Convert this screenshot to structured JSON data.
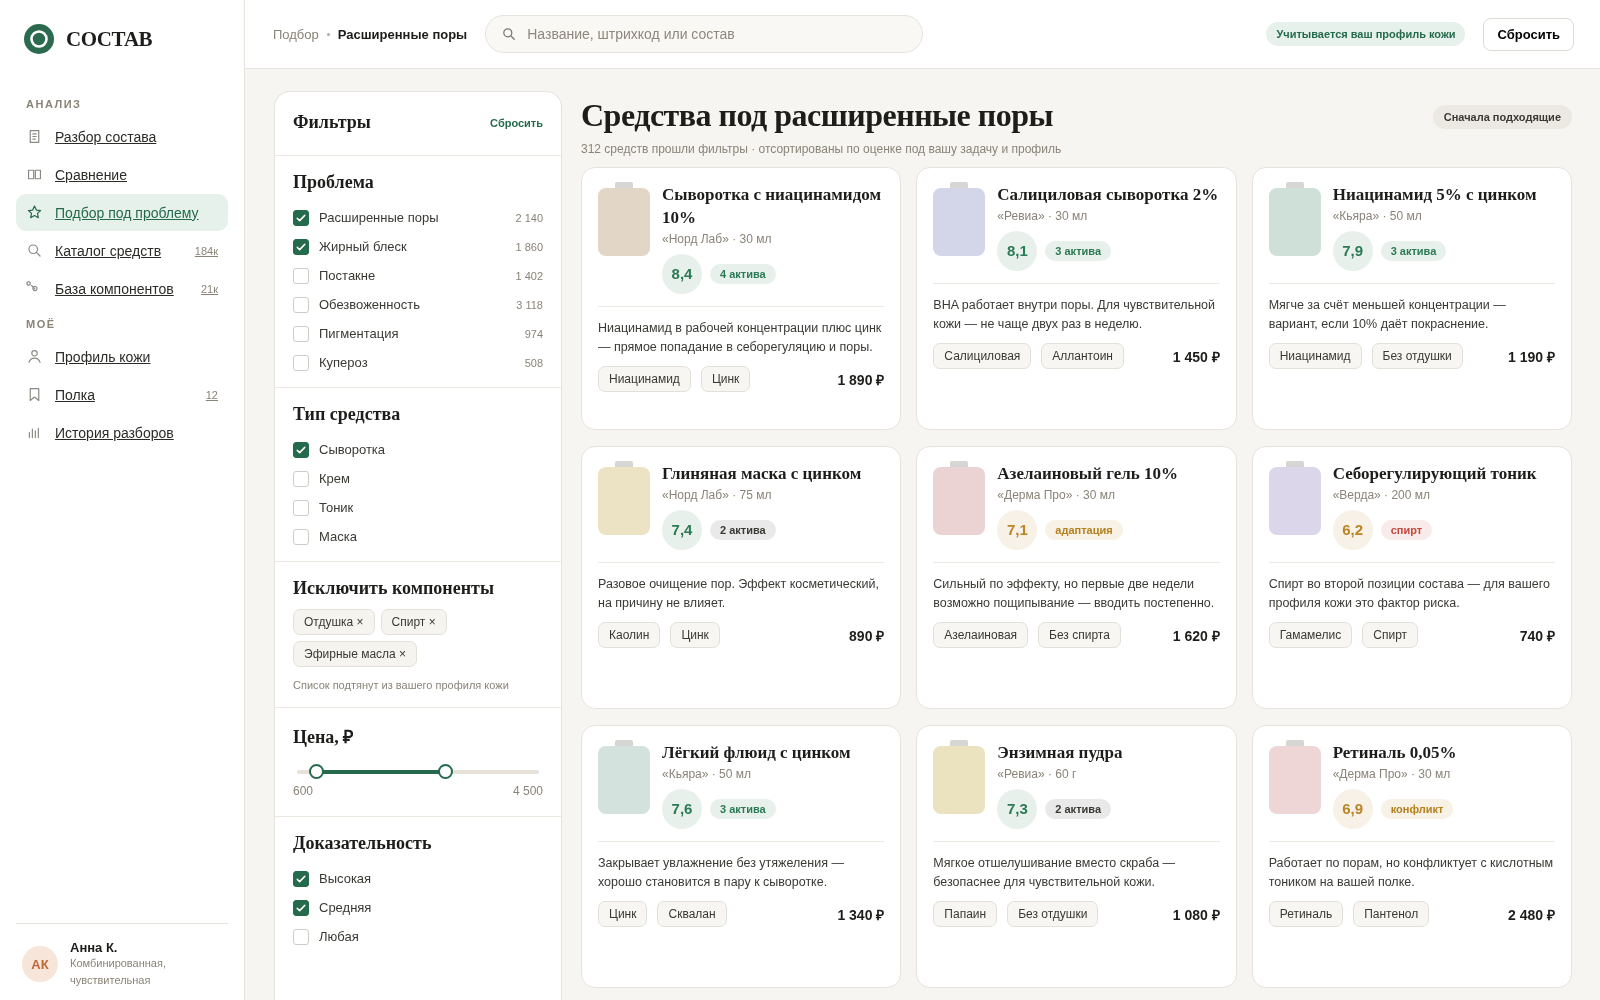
{
  "brand": {
    "name": "СОСТАВ"
  },
  "sidebar": {
    "sections": [
      {
        "title": "АНАЛИЗ",
        "items": [
          {
            "label": "Разбор состава",
            "selected": false
          },
          {
            "label": "Сравнение",
            "selected": false
          },
          {
            "label": "Подбор под проблему",
            "selected": true
          },
          {
            "label": "Каталог средств",
            "count": "184к",
            "selected": false
          },
          {
            "label": "База компонентов",
            "count": "21к",
            "selected": false
          }
        ]
      },
      {
        "title": "МОЁ",
        "items": [
          {
            "label": "Профиль кожи",
            "selected": false
          },
          {
            "label": "Полка",
            "count": "12",
            "selected": false
          },
          {
            "label": "История разборов",
            "selected": false
          }
        ]
      }
    ],
    "user": {
      "initials": "АК",
      "name": "Анна К.",
      "skin": "Комбинированная, чувствительная"
    }
  },
  "topbar": {
    "breadcrumb": [
      "Подбор",
      "Расширенные поры"
    ],
    "search": {
      "placeholder": "Название, штрихкод или состав"
    },
    "profile_badge": "Учитывается ваш профиль кожи",
    "reset_button": "Сбросить"
  },
  "filters": {
    "title": "Фильтры",
    "reset": "Сбросить",
    "problem": {
      "title": "Проблема",
      "options": [
        {
          "label": "Расширенные поры",
          "count": "2 140",
          "checked": true
        },
        {
          "label": "Жирный блеск",
          "count": "1 860",
          "checked": true
        },
        {
          "label": "Постакне",
          "count": "1 402",
          "checked": false
        },
        {
          "label": "Обезвоженность",
          "count": "3 118",
          "checked": false
        },
        {
          "label": "Пигментация",
          "count": "974",
          "checked": false
        },
        {
          "label": "Купероз",
          "count": "508",
          "checked": false
        }
      ]
    },
    "type": {
      "title": "Тип средства",
      "options": [
        {
          "label": "Сыворотка",
          "checked": true
        },
        {
          "label": "Крем",
          "checked": false
        },
        {
          "label": "Тоник",
          "checked": false
        },
        {
          "label": "Маска",
          "checked": false
        }
      ]
    },
    "exclude": {
      "title": "Исключить компоненты",
      "chips": [
        "Отдушка ×",
        "Спирт ×",
        "Эфирные масла ×"
      ],
      "note": "Список подтянут из вашего профиля кожи"
    },
    "price": {
      "title": "Цена, ₽",
      "thumbs": [
        {
          "level": 0.08
        },
        {
          "level": 0.61
        }
      ],
      "min": "600",
      "max": "4 500"
    },
    "evidence": {
      "title": "Доказательность",
      "options": [
        {
          "label": "Высокая",
          "checked": true
        },
        {
          "label": "Средняя",
          "checked": true
        },
        {
          "label": "Любая",
          "checked": false
        }
      ]
    }
  },
  "results": {
    "title": "Средства под расширенные поры",
    "subtitle": "312 средств прошли фильтры · отсортированы по оценке под вашу задачу и профиль",
    "sort": "Сначала подходящие",
    "products": [
      {
        "name": "Сыворотка с ниацинамидом 10%",
        "meta": "«Норд Лаб» · 30 мл",
        "color": "#e2d6c6",
        "score": {
          "value": "8,4",
          "color": "#2a7a52"
        },
        "badge": {
          "label": "4 актива",
          "color": "#2a7a52"
        },
        "text": "Ниацинамид в рабочей концентрации плюс цинк — прямое попадание в себорегуляцию и поры.",
        "tags": [
          "Ниацинамид",
          "Цинк"
        ],
        "price": "1 890 ₽"
      },
      {
        "name": "Салициловая сыворотка 2%",
        "meta": "«Ревиа» · 30 мл",
        "color": "#d3d6e8",
        "score": {
          "value": "8,1",
          "color": "#2a7a52"
        },
        "badge": {
          "label": "3 актива",
          "color": "#2a7a52"
        },
        "text": "BHA работает внутри поры. Для чувствительной кожи — не чаще двух раз в неделю.",
        "tags": [
          "Салициловая",
          "Аллантоин"
        ],
        "price": "1 450 ₽"
      },
      {
        "name": "Ниацинамид 5% с цинком",
        "meta": "«Кьяра» · 50 мл",
        "color": "#cfe0d8",
        "score": {
          "value": "7,9",
          "color": "#2a7a52"
        },
        "badge": {
          "label": "3 актива",
          "color": "#2a7a52"
        },
        "text": "Мягче за счёт меньшей концентрации — вариант, если 10% даёт покраснение.",
        "tags": [
          "Ниацинамид",
          "Без отдушки"
        ],
        "price": "1 190 ₽"
      },
      {
        "name": "Глиняная маска с цинком",
        "meta": "«Норд Лаб» · 75 мл",
        "color": "#ebe3c4",
        "score": {
          "value": "7,4",
          "color": "#2a7a52"
        },
        "badge": {
          "label": "2 актива",
          "color": "#3a3934"
        },
        "text": "Разовое очищение пор. Эффект косметический, на причину не влияет.",
        "tags": [
          "Каолин",
          "Цинк"
        ],
        "price": "890 ₽"
      },
      {
        "name": "Азелаиновый гель 10%",
        "meta": "«Дерма Про» · 30 мл",
        "color": "#ecd3d3",
        "score": {
          "value": "7,1",
          "color": "#bb8424"
        },
        "badge": {
          "label": "адаптация",
          "color": "#b5801e"
        },
        "text": "Сильный по эффекту, но первые две недели возможно пощипывание — вводить постепенно.",
        "tags": [
          "Азелаиновая",
          "Без спирта"
        ],
        "price": "1 620 ₽"
      },
      {
        "name": "Себорегулирующий тоник",
        "meta": "«Верда» · 200 мл",
        "color": "#dcd6ea",
        "score": {
          "value": "6,2",
          "color": "#bb8424"
        },
        "badge": {
          "label": "спирт",
          "color": "#c4473c"
        },
        "text": "Спирт во второй позиции состава — для вашего профиля кожи это фактор риска.",
        "tags": [
          "Гамамелис",
          "Спирт"
        ],
        "price": "740 ₽"
      },
      {
        "name": "Лёгкий флюид с цинком",
        "meta": "«Кьяра» · 50 мл",
        "color": "#d3e2dc",
        "score": {
          "value": "7,6",
          "color": "#2a7a52"
        },
        "badge": {
          "label": "3 актива",
          "color": "#2a7a52"
        },
        "text": "Закрывает увлажнение без утяжеления — хорошо становится в пару к сыворотке.",
        "tags": [
          "Цинк",
          "Сквалан"
        ],
        "price": "1 340 ₽"
      },
      {
        "name": "Энзимная пудра",
        "meta": "«Ревиа» · 60 г",
        "color": "#ebe2c0",
        "score": {
          "value": "7,3",
          "color": "#2a7a52"
        },
        "badge": {
          "label": "2 актива",
          "color": "#3a3934"
        },
        "text": "Мягкое отшелушивание вместо скраба — безопаснее для чувствительной кожи.",
        "tags": [
          "Папаин",
          "Без отдушки"
        ],
        "price": "1 080 ₽"
      },
      {
        "name": "Ретиналь 0,05%",
        "meta": "«Дерма Про» · 30 мл",
        "color": "#efd6d6",
        "score": {
          "value": "6,9",
          "color": "#bb8424"
        },
        "badge": {
          "label": "конфликт",
          "color": "#b5801e"
        },
        "text": "Работает по порам, но конфликтует с кислотным тоником на вашей полке.",
        "tags": [
          "Ретиналь",
          "Пантенол"
        ],
        "price": "2 480 ₽"
      }
    ]
  }
}
